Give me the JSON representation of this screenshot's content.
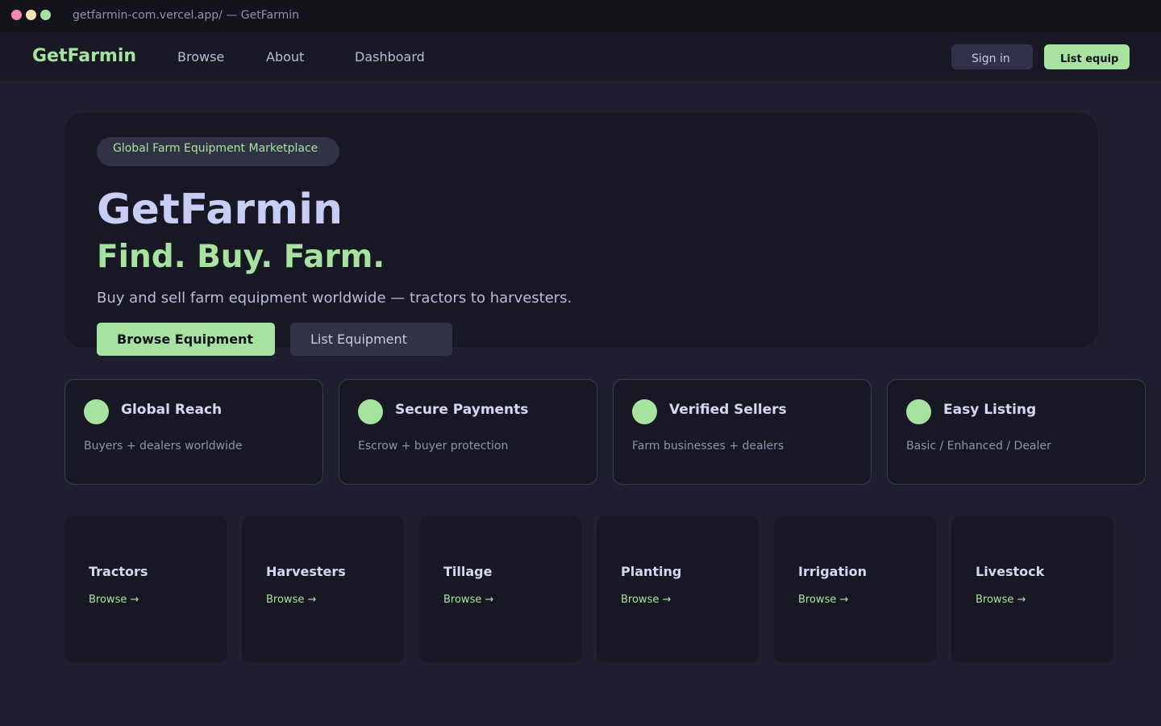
{
  "window": {
    "title": "getfarmin-com.vercel.app/ — GetFarmin"
  },
  "nav": {
    "brand": "GetFarmin",
    "links": [
      "Browse",
      "About",
      "Dashboard"
    ],
    "sign_in": "Sign in",
    "list_equip": "List equip"
  },
  "hero": {
    "badge": "Global Farm Equipment Marketplace",
    "title": "GetFarmin",
    "tagline": "Find. Buy. Farm.",
    "subtitle": "Buy and sell farm equipment worldwide — tractors to harvesters.",
    "primary_button": "Browse Equipment",
    "secondary_button": "List Equipment"
  },
  "features": [
    {
      "title": "Global Reach",
      "desc": "Buyers + dealers worldwide"
    },
    {
      "title": "Secure Payments",
      "desc": "Escrow + buyer protection"
    },
    {
      "title": "Verified Sellers",
      "desc": "Farm businesses + dealers"
    },
    {
      "title": "Easy Listing",
      "desc": "Basic / Enhanced / Dealer"
    }
  ],
  "categories": [
    {
      "name": "Tractors",
      "link": "Browse →"
    },
    {
      "name": "Harvesters",
      "link": "Browse →"
    },
    {
      "name": "Tillage",
      "link": "Browse →"
    },
    {
      "name": "Planting",
      "link": "Browse →"
    },
    {
      "name": "Irrigation",
      "link": "Browse →"
    },
    {
      "name": "Livestock",
      "link": "Browse →"
    }
  ],
  "colors": {
    "accent": "#a6e3a1",
    "background": "#1f1f2f",
    "surface": "#181825",
    "text": "#c8cdf5"
  }
}
